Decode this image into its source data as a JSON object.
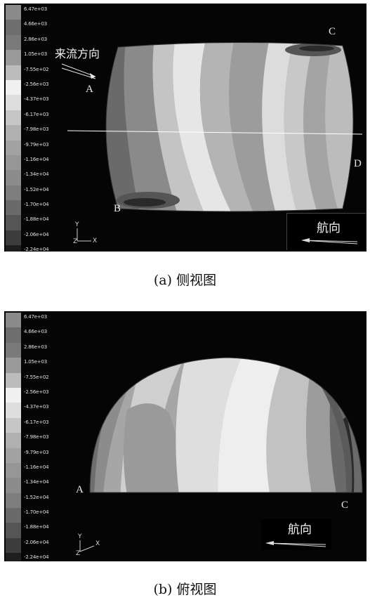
{
  "legend": {
    "levels": [
      "6.47e+03",
      "4.66e+03",
      "2.86e+03",
      "1.05e+03",
      "-7.55e+02",
      "-2.56e+03",
      "-4.37e+03",
      "-6.17e+03",
      "-7.98e+03",
      "-9.79e+03",
      "-1.16e+04",
      "-1.34e+04",
      "-1.52e+04",
      "-1.70e+04",
      "-1.88e+04",
      "-2.06e+04",
      "-2.24e+04"
    ],
    "colors": [
      "#8a8a8a",
      "#6e6e6e",
      "#7a7a7a",
      "#9a9a9a",
      "#bcbcbc",
      "#f0f0f0",
      "#dedede",
      "#c6c6c6",
      "#b0b0b0",
      "#a2a2a2",
      "#969696",
      "#8c8c8c",
      "#7e7e7e",
      "#6a6a6a",
      "#555555",
      "#3c3c3c",
      "#1e1e1e"
    ]
  },
  "panel_a": {
    "flow_label": "来流方向",
    "points": {
      "A": "A",
      "B": "B",
      "C": "C",
      "D": "D"
    },
    "heading_label": "航向",
    "axis": {
      "y": "Y",
      "z": "Z",
      "x": "X"
    },
    "caption": "(a) 侧视图"
  },
  "panel_b": {
    "points": {
      "A": "A",
      "C": "C"
    },
    "heading_label": "航向",
    "axis": {
      "y": "Y",
      "z": "Z",
      "x": "X"
    },
    "caption": "(b) 俯视图"
  }
}
